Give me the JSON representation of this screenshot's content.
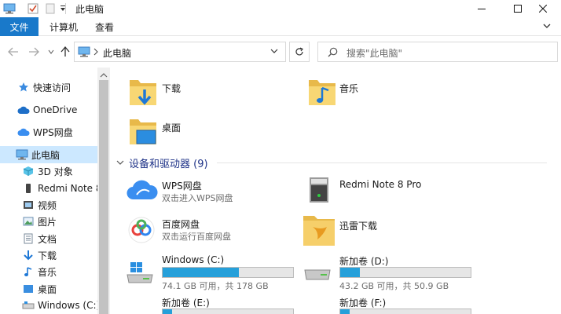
{
  "window": {
    "title": "此电脑"
  },
  "ribbon": {
    "file": "文件",
    "computer": "计算机",
    "view": "查看"
  },
  "address": {
    "path": "此电脑"
  },
  "search": {
    "placeholder": "搜索\"此电脑\""
  },
  "sidebar": {
    "items": [
      {
        "label": "快速访问",
        "icon": "star-icon"
      },
      {
        "label": "OneDrive",
        "icon": "cloud-icon"
      },
      {
        "label": "WPS网盘",
        "icon": "wps-cloud-icon"
      },
      {
        "label": "此电脑",
        "icon": "computer-icon",
        "selected": true
      },
      {
        "label": "3D 对象",
        "icon": "cube-icon"
      },
      {
        "label": "Redmi Note 8",
        "icon": "phone-icon"
      },
      {
        "label": "视频",
        "icon": "video-icon"
      },
      {
        "label": "图片",
        "icon": "pictures-icon"
      },
      {
        "label": "文档",
        "icon": "document-icon"
      },
      {
        "label": "下载",
        "icon": "download-icon"
      },
      {
        "label": "音乐",
        "icon": "music-icon"
      },
      {
        "label": "桌面",
        "icon": "desktop-icon"
      },
      {
        "label": "Windows (C:)",
        "icon": "drive-icon"
      }
    ]
  },
  "folders": [
    {
      "name": "下载",
      "icon": "download-folder-icon"
    },
    {
      "name": "音乐",
      "icon": "music-folder-icon"
    },
    {
      "name": "桌面",
      "icon": "desktop-folder-icon"
    }
  ],
  "devices": {
    "heading": "设备和驱动器 (9)",
    "apps": [
      {
        "name": "WPS网盘",
        "sub": "双击进入WPS网盘",
        "icon": "wps-cloud-icon"
      },
      {
        "name": "Redmi Note 8 Pro",
        "sub": "",
        "icon": "phone-device-icon"
      },
      {
        "name": "百度网盘",
        "sub": "双击运行百度网盘",
        "icon": "baidu-netdisk-icon"
      },
      {
        "name": "迅雷下载",
        "sub": "",
        "icon": "thunder-folder-icon"
      }
    ],
    "drives": [
      {
        "name": "Windows (C:)",
        "free": "74.1 GB 可用，共 178 GB",
        "used_fraction": 0.584
      },
      {
        "name": "新加卷 (D:)",
        "free": "43.2 GB 可用，共 50.9 GB",
        "used_fraction": 0.151
      },
      {
        "name": "新加卷 (E:)",
        "free": "",
        "used_fraction": 0.07
      },
      {
        "name": "新加卷 (F:)",
        "free": "",
        "used_fraction": 0.07
      }
    ]
  },
  "colors": {
    "accent": "#1979ca",
    "selection": "#cce8ff",
    "bar_fill": "#26a0da",
    "group_heading": "#1e3287"
  }
}
